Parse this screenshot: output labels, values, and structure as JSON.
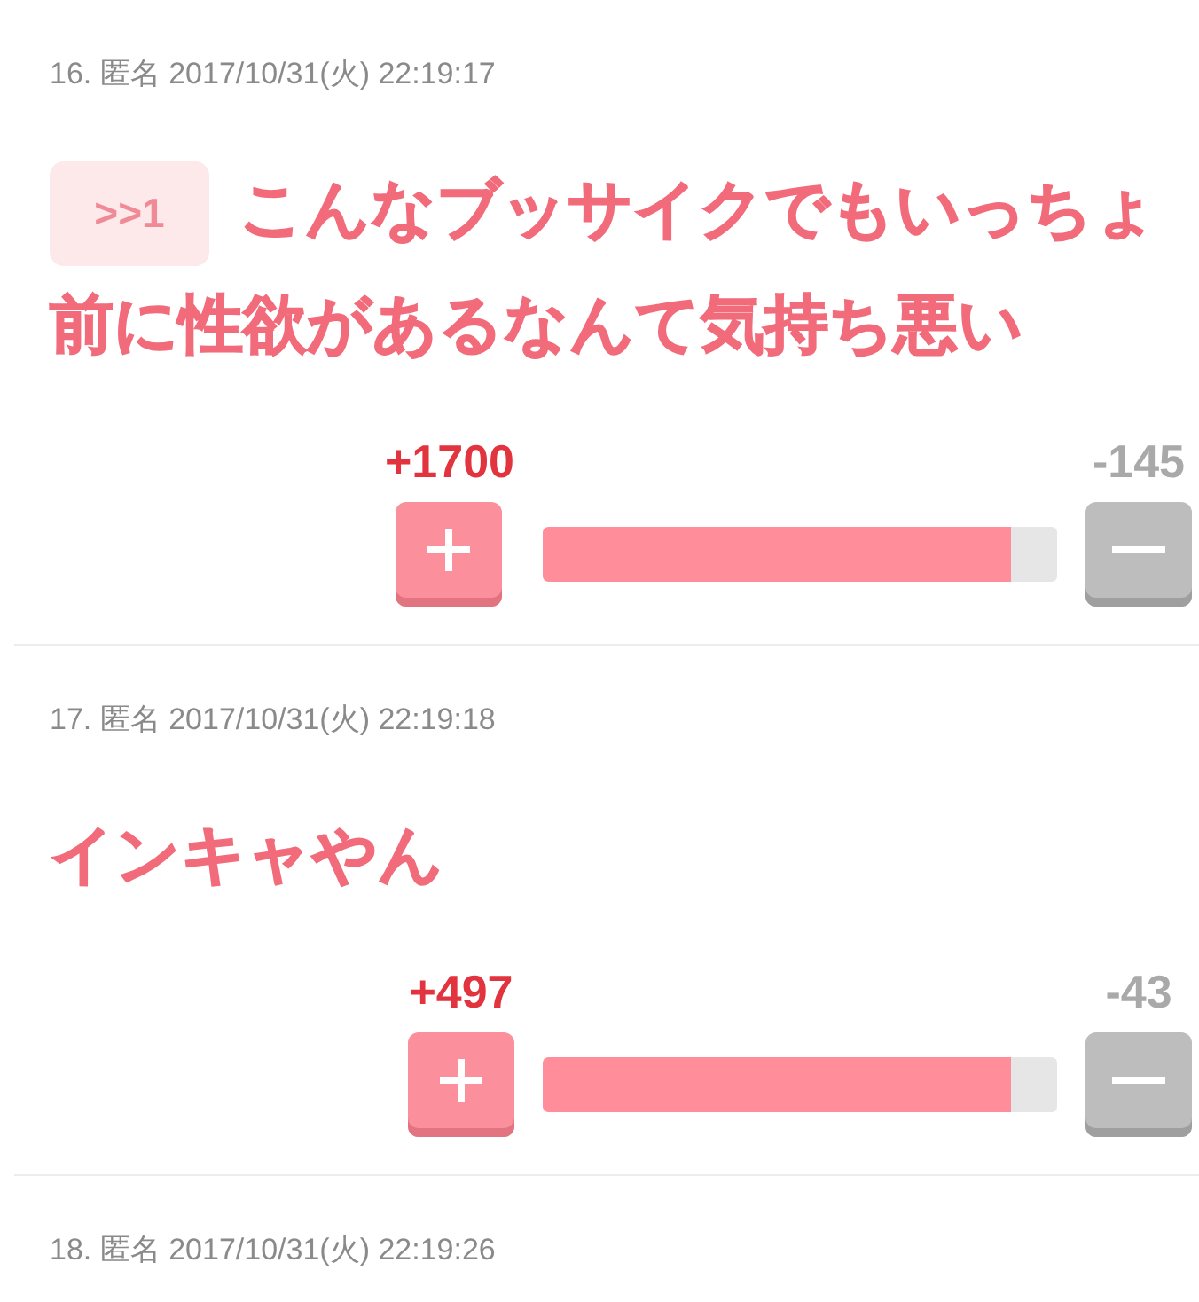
{
  "comments": [
    {
      "meta": "16. 匿名 2017/10/31(火) 22:19:17",
      "reply_to": ">>1",
      "body": "こんなブッサイクでもいっちょ前に性欲があるなんて気持ち悪い",
      "vote": {
        "plus_count": "+1700",
        "minus_count": "-145",
        "level": 0.91
      }
    },
    {
      "meta": "17. 匿名 2017/10/31(火) 22:19:18",
      "body": "インキャやん",
      "vote": {
        "plus_count": "+497",
        "minus_count": "-43",
        "level": 0.91
      }
    },
    {
      "meta": "18. 匿名 2017/10/31(火) 22:19:26"
    }
  ]
}
